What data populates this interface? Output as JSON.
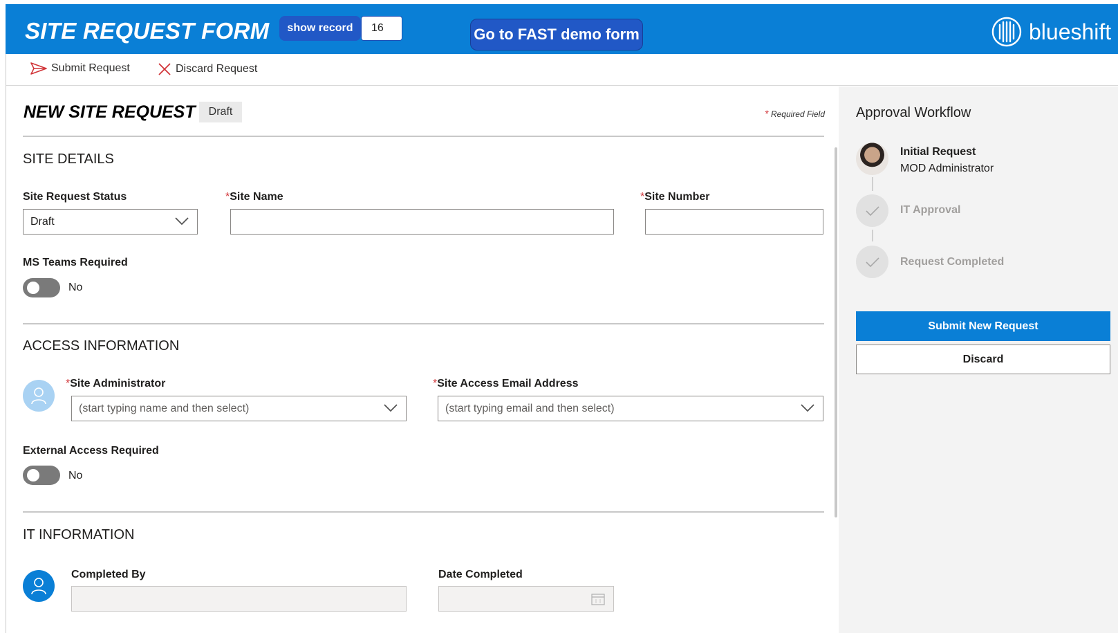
{
  "header": {
    "title": "SITE REQUEST FORM",
    "show_record_label": "show record",
    "record_value": "16",
    "demo_button_label": "Go to FAST demo form",
    "logo_text": "blueshift",
    "logo_icon": "blueshift-logo-icon"
  },
  "commands": {
    "submit_label": "Submit Request",
    "discard_label": "Discard Request"
  },
  "form": {
    "title": "NEW SITE REQUEST",
    "status_badge": "Draft",
    "required_note_star": "*",
    "required_note": "Required Field"
  },
  "site_details": {
    "section_title": "SITE DETAILS",
    "status_label": "Site Request Status",
    "status_value": "Draft",
    "site_name_label": "Site Name",
    "site_name_value": "",
    "site_number_label": "Site Number",
    "site_number_value": "",
    "teams_label": "MS Teams Required",
    "teams_value": "No"
  },
  "access": {
    "section_title": "ACCESS INFORMATION",
    "admin_label": "Site Administrator",
    "admin_placeholder": "(start typing name and then select)",
    "email_label": "Site Access Email Address",
    "email_placeholder": "(start typing email and then select)",
    "external_label": "External Access Required",
    "external_value": "No"
  },
  "it_info": {
    "section_title": "IT INFORMATION",
    "completed_by_label": "Completed By",
    "completed_by_value": "",
    "date_completed_label": "Date Completed",
    "date_completed_value": ""
  },
  "workflow": {
    "title": "Approval Workflow",
    "steps": [
      {
        "title": "Initial Request",
        "subtitle": "MOD Administrator",
        "status": "active"
      },
      {
        "title": "IT Approval",
        "status": "pending"
      },
      {
        "title": "Request Completed",
        "status": "pending"
      }
    ],
    "submit_label": "Submit New Request",
    "discard_label": "Discard"
  },
  "colors": {
    "brand_blue": "#0a7fd6",
    "button_blue": "#2158c6",
    "required_red": "#d13438"
  }
}
